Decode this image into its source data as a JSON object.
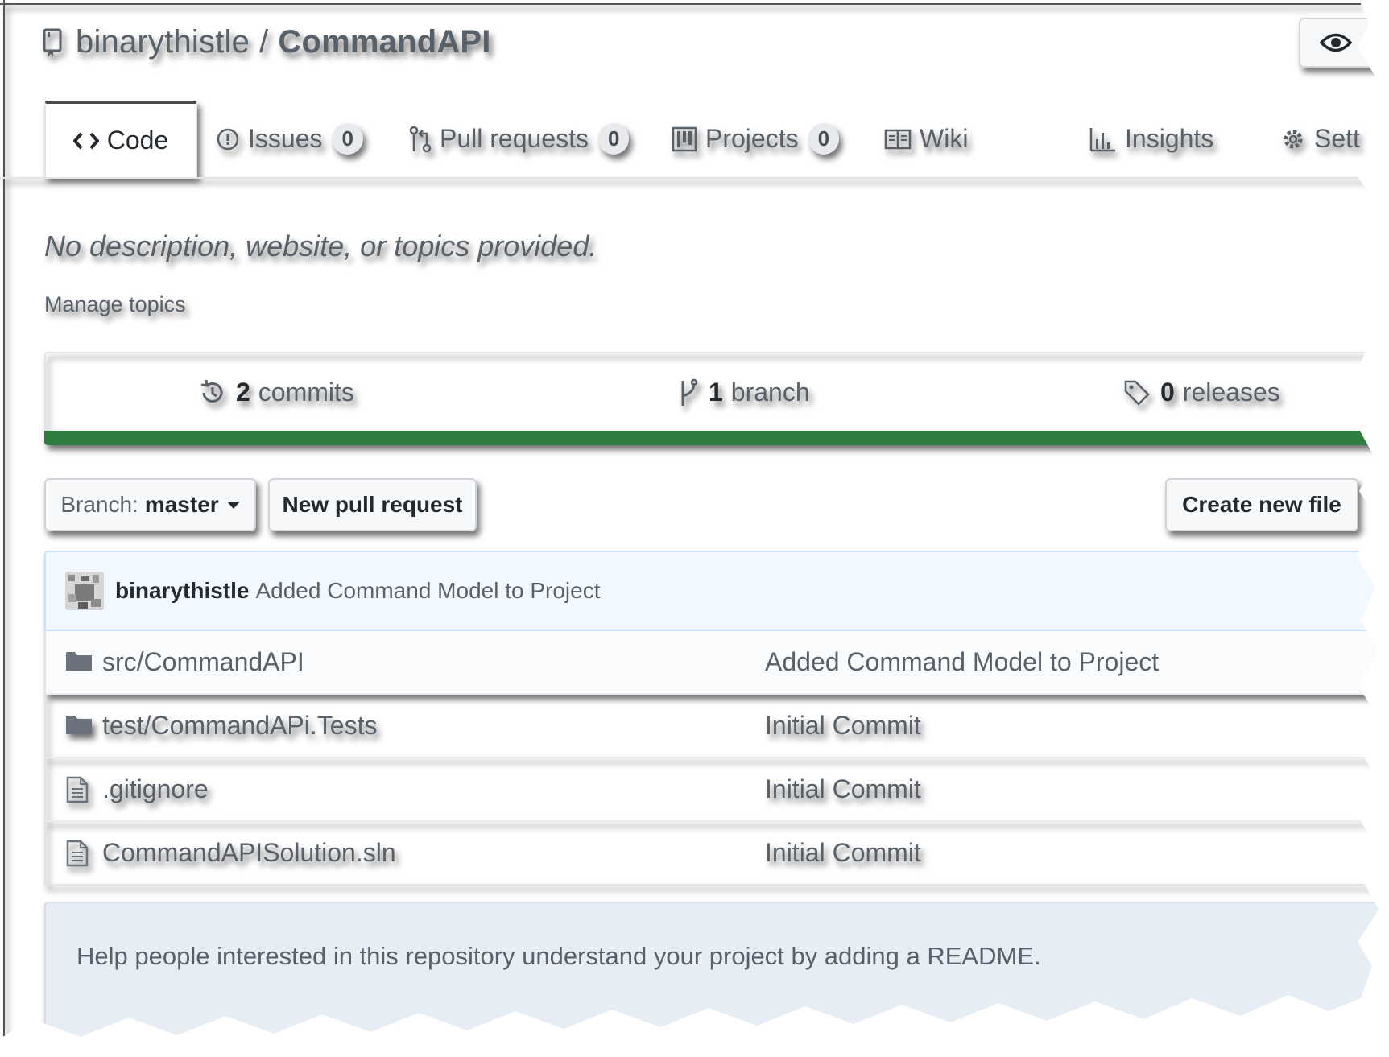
{
  "repo": {
    "owner": "binarythistle",
    "separator": "/",
    "name": "CommandAPI"
  },
  "tabs": [
    {
      "label": "Code",
      "icon": "code-icon",
      "selected": true
    },
    {
      "label": "Issues",
      "icon": "issue-opened-icon",
      "count": "0"
    },
    {
      "label": "Pull requests",
      "icon": "git-pull-request-icon",
      "count": "0"
    },
    {
      "label": "Projects",
      "icon": "project-icon",
      "count": "0"
    },
    {
      "label": "Wiki",
      "icon": "book-icon"
    },
    {
      "label": "Insights",
      "icon": "graph-icon"
    },
    {
      "label": "Sett",
      "icon": "gear-icon"
    }
  ],
  "description": "No description, website, or topics provided.",
  "manage_topics": "Manage topics",
  "summary": {
    "commits": {
      "count": "2",
      "label": "commits"
    },
    "branches": {
      "count": "1",
      "label": "branch"
    },
    "releases": {
      "count": "0",
      "label": "releases"
    }
  },
  "language_color": "#2c7d3e",
  "toolbar": {
    "branch_label": "Branch:",
    "branch_value": "master",
    "new_pull_request": "New pull request",
    "create_new_file": "Create new file"
  },
  "latest_commit": {
    "author": "binarythistle",
    "message": "Added Command Model to Project"
  },
  "files": [
    {
      "type": "directory",
      "icon": "folder-icon",
      "name": "src/CommandAPI",
      "message": "Added Command Model to Project"
    },
    {
      "type": "directory",
      "icon": "folder-icon",
      "name": "test/CommandAPi.Tests",
      "message": "Initial Commit"
    },
    {
      "type": "file",
      "icon": "file-icon",
      "name": ".gitignore",
      "message": "Initial Commit"
    },
    {
      "type": "file",
      "icon": "file-icon",
      "name": "CommandAPISolution.sln",
      "message": "Initial Commit"
    }
  ],
  "readme_prompt": "Help people interested in this repository understand your project by adding a README."
}
